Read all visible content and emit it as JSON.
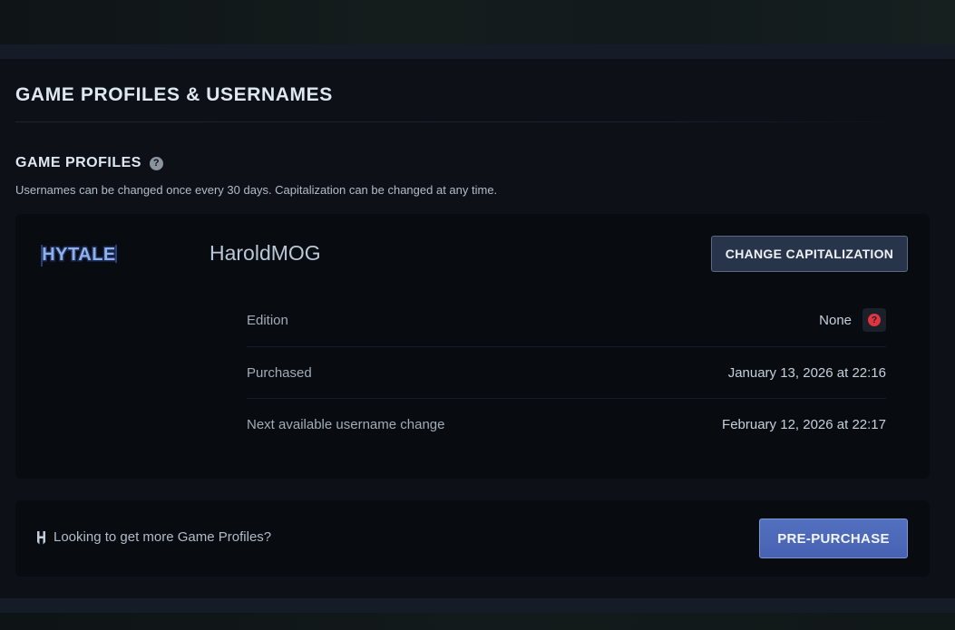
{
  "page": {
    "title": "GAME PROFILES & USERNAMES"
  },
  "section": {
    "title": "GAME PROFILES",
    "description": "Usernames can be changed once every 30 days. Capitalization can be changed at any time."
  },
  "profile": {
    "game_logo_text": "HYTALE",
    "username": "HaroldMOG",
    "change_button_label": "CHANGE CAPITALIZATION",
    "details": [
      {
        "label": "Edition",
        "value": "None"
      },
      {
        "label": "Purchased",
        "value": "January 13, 2026 at 22:16"
      },
      {
        "label": "Next available username change",
        "value": "February 12, 2026 at 22:17"
      }
    ]
  },
  "promo": {
    "text": "Looking to get more Game Profiles?",
    "button_label": "PRE-PURCHASE"
  },
  "icons": {
    "section_help": "question-circle-icon",
    "edition_info": "question-circle-icon",
    "promo": "hytale-h-icon"
  },
  "colors": {
    "accent_button": "#4f6bbb",
    "secondary_button": "#28344a",
    "alert": "#e0343e"
  }
}
